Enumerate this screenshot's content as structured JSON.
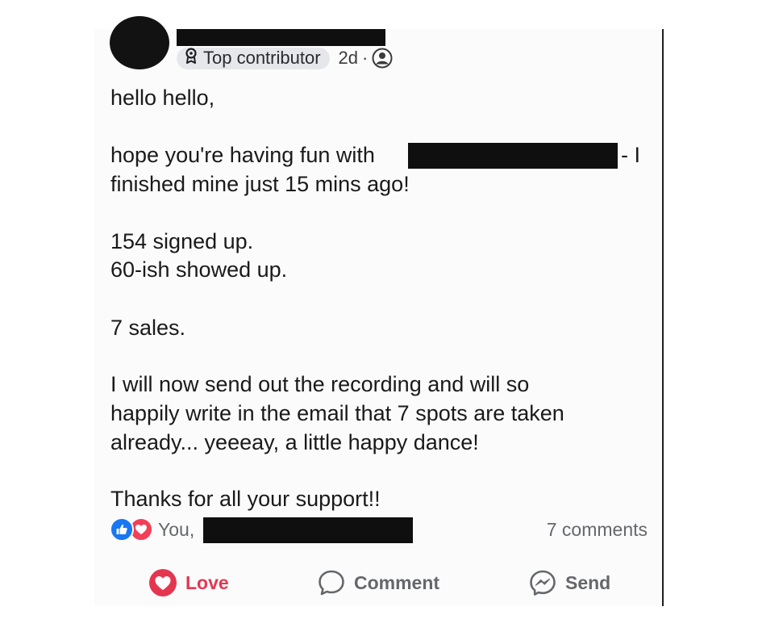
{
  "post": {
    "badge_label": "Top contributor",
    "time": "2d",
    "separator": "·",
    "lines": [
      "hello hello,",
      "hope you're having fun with",
      "- I",
      "finished mine just 15 mins ago!",
      "154 signed up.",
      "60-ish showed up.",
      "7 sales.",
      "I will now send out the recording and will so",
      "happily write in the email that 7 spots are taken",
      "already... yeeeay, a little happy dance!",
      "Thanks for all your support!!"
    ]
  },
  "reactions": {
    "text": "You,",
    "comments": "7 comments"
  },
  "actions": {
    "love": "Love",
    "comment": "Comment",
    "send": "Send"
  },
  "colors": {
    "love_red": "#e4374f",
    "like_blue": "#1877f2",
    "redaction": "#0f0f0f",
    "muted": "#65676b"
  },
  "icons": {
    "badge": "contributor-badge-icon",
    "privacy": "friends-icon",
    "like": "thumbs-up-icon",
    "love": "heart-icon",
    "comment": "speech-bubble-icon",
    "send": "messenger-icon"
  }
}
